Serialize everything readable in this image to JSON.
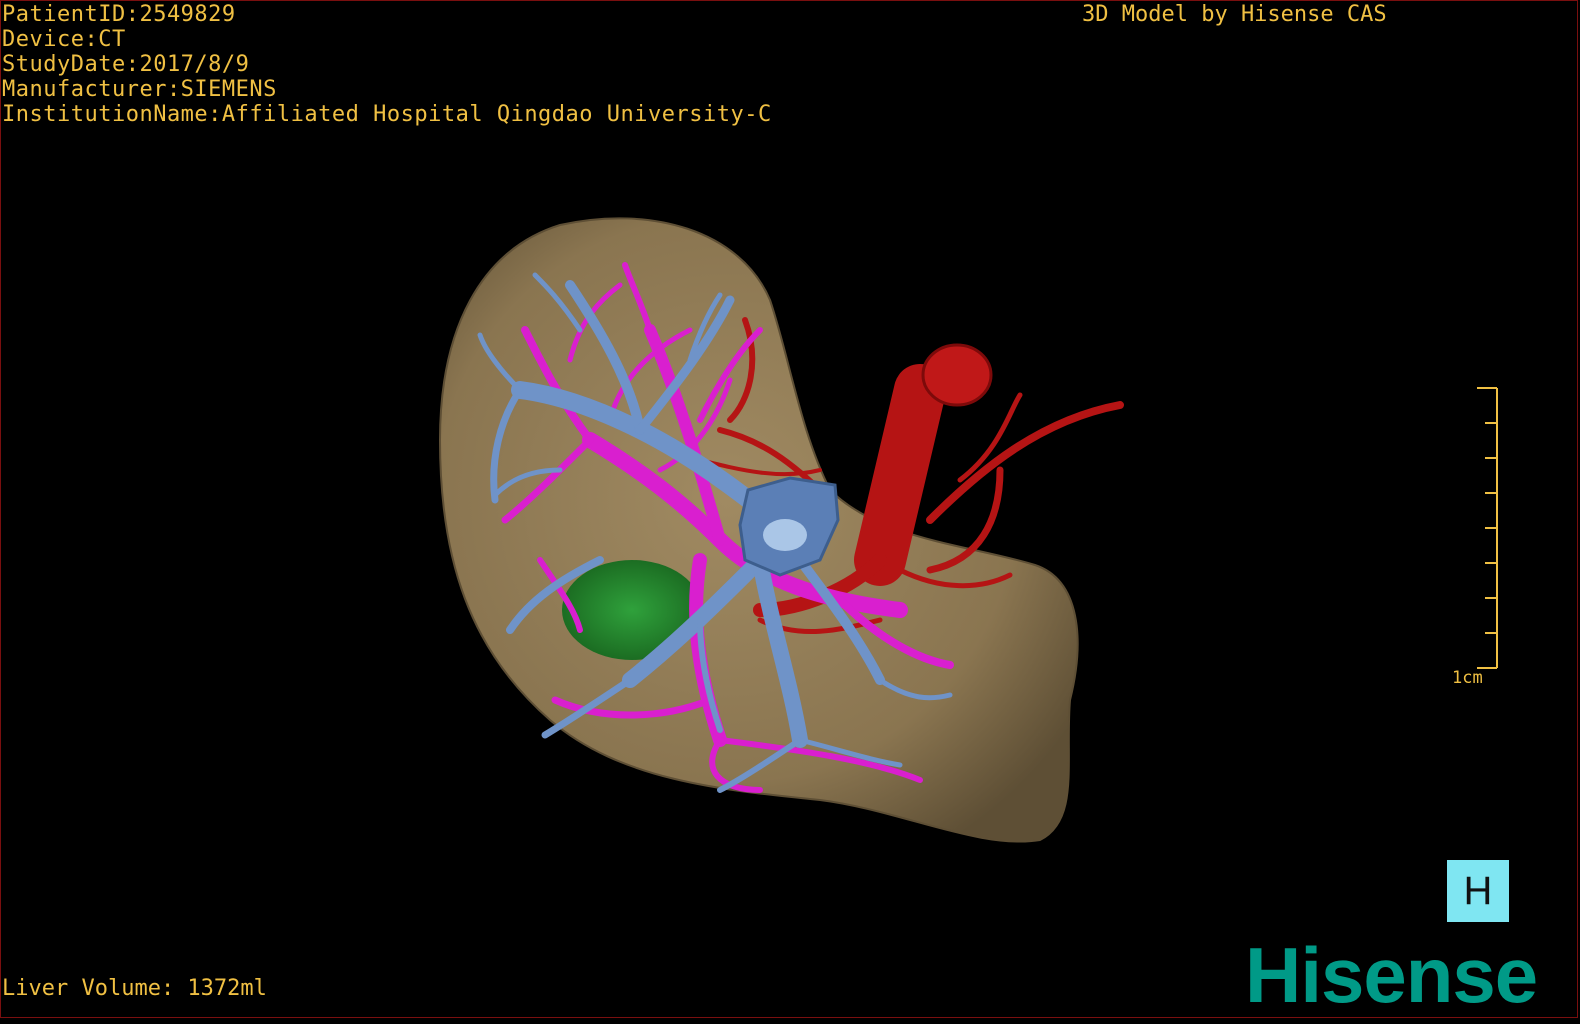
{
  "header": {
    "patient_id": "PatientID:2549829",
    "device": "Device:CT",
    "study_date": "StudyDate:2017/8/9",
    "manufacturer": "Manufacturer:SIEMENS",
    "institution": "InstitutionName:Affiliated Hospital Qingdao University-C"
  },
  "credit": "3D Model by Hisense CAS",
  "scale_bar": {
    "label": "1cm"
  },
  "footer": {
    "liver_volume": "Liver Volume: 1372ml"
  },
  "orientation_cube": {
    "label": "H"
  },
  "brand": {
    "logo_text": "Hisense"
  },
  "colors": {
    "overlay_text": "#f0c043",
    "liver": "#8f7a55",
    "portal_vein": "#6f93c8",
    "hepatic_vein": "#d91fcf",
    "artery": "#b51414",
    "lesion": "#1f8a2a",
    "brand": "#009a87",
    "orientation_cube": "#7fe6f2"
  }
}
